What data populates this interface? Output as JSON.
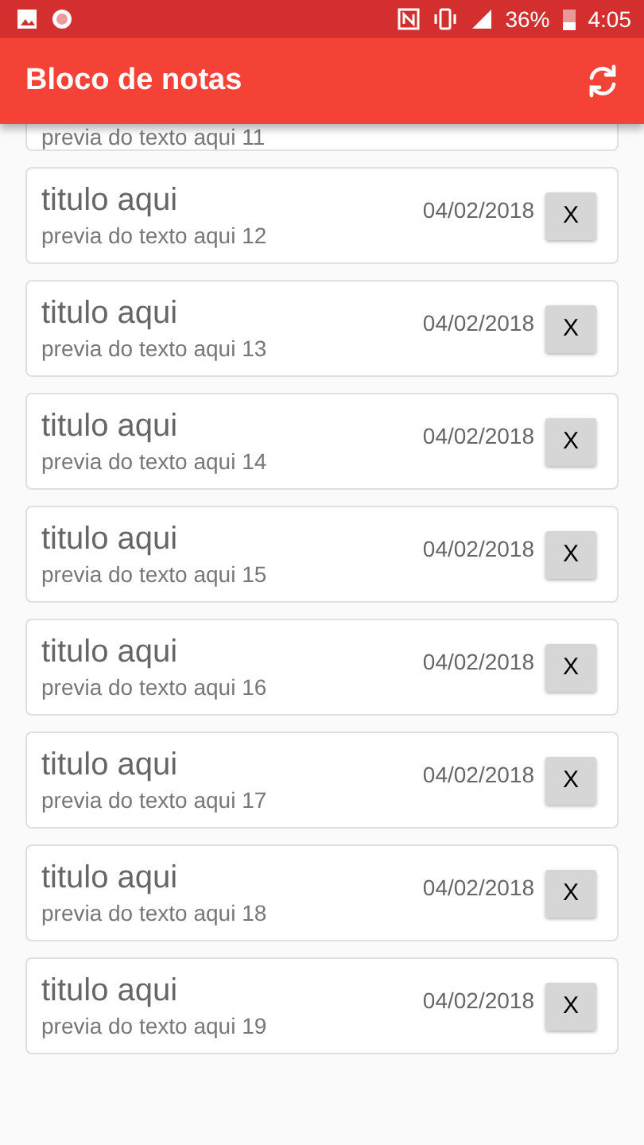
{
  "status_bar": {
    "battery": "36%",
    "time": "4:05"
  },
  "app_bar": {
    "title": "Bloco de notas"
  },
  "partial_note": {
    "preview": "previa do texto aqui 11"
  },
  "notes": [
    {
      "title": "titulo aqui",
      "preview": "previa do texto aqui 12",
      "date": "04/02/2018",
      "delete": "X"
    },
    {
      "title": "titulo aqui",
      "preview": "previa do texto aqui 13",
      "date": "04/02/2018",
      "delete": "X"
    },
    {
      "title": "titulo aqui",
      "preview": "previa do texto aqui 14",
      "date": "04/02/2018",
      "delete": "X"
    },
    {
      "title": "titulo aqui",
      "preview": "previa do texto aqui 15",
      "date": "04/02/2018",
      "delete": "X"
    },
    {
      "title": "titulo aqui",
      "preview": "previa do texto aqui 16",
      "date": "04/02/2018",
      "delete": "X"
    },
    {
      "title": "titulo aqui",
      "preview": "previa do texto aqui 17",
      "date": "04/02/2018",
      "delete": "X"
    },
    {
      "title": "titulo aqui",
      "preview": "previa do texto aqui 18",
      "date": "04/02/2018",
      "delete": "X"
    },
    {
      "title": "titulo aqui",
      "preview": "previa do texto aqui 19",
      "date": "04/02/2018",
      "delete": "X"
    }
  ]
}
